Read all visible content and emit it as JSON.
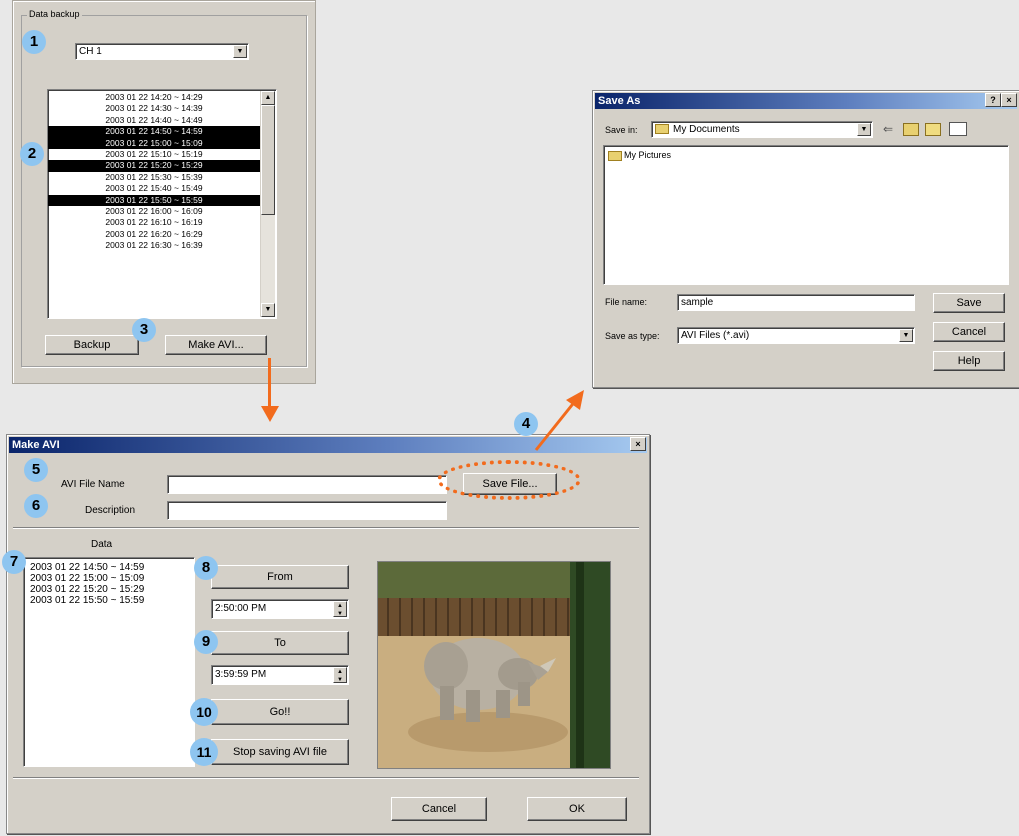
{
  "backup_panel": {
    "group_label": "Data backup",
    "channel_value": "CH 1",
    "list_items": [
      {
        "text": "2003 01 22 14:20 ~ 14:29",
        "selected": false
      },
      {
        "text": "2003 01 22 14:30 ~ 14:39",
        "selected": false
      },
      {
        "text": "2003 01 22 14:40 ~ 14:49",
        "selected": false
      },
      {
        "text": "2003 01 22 14:50 ~ 14:59",
        "selected": true
      },
      {
        "text": "2003 01 22 15:00 ~ 15:09",
        "selected": true
      },
      {
        "text": "2003 01 22 15:10 ~ 15:19",
        "selected": false
      },
      {
        "text": "2003 01 22 15:20 ~ 15:29",
        "selected": true
      },
      {
        "text": "2003 01 22 15:30 ~ 15:39",
        "selected": false
      },
      {
        "text": "2003 01 22 15:40 ~ 15:49",
        "selected": false
      },
      {
        "text": "2003 01 22 15:50 ~ 15:59",
        "selected": true
      },
      {
        "text": "2003 01 22 16:00 ~ 16:09",
        "selected": false
      },
      {
        "text": "2003 01 22 16:10 ~ 16:19",
        "selected": false
      },
      {
        "text": "2003 01 22 16:20 ~ 16:29",
        "selected": false
      },
      {
        "text": "2003 01 22 16:30 ~ 16:39",
        "selected": false
      }
    ],
    "backup_button": "Backup",
    "make_avi_button": "Make AVI..."
  },
  "save_as": {
    "title": "Save As",
    "help_btn": "?",
    "close_btn": "×",
    "save_in_label": "Save in:",
    "save_in_value": "My Documents",
    "folder_item": "My Pictures",
    "file_name_label": "File name:",
    "file_name_value": "sample",
    "save_type_label": "Save as type:",
    "save_type_value": "AVI Files (*.avi)",
    "save_button": "Save",
    "cancel_button": "Cancel",
    "help_button": "Help"
  },
  "make_avi": {
    "title": "Make AVI",
    "close_btn": "×",
    "avi_file_name_label": "AVI File Name",
    "avi_file_name_value": "",
    "description_label": "Description",
    "description_value": "",
    "save_file_button": "Save File...",
    "data_label": "Data",
    "data_items": [
      "2003 01 22 14:50 ~ 14:59",
      "2003 01 22 15:00 ~ 15:09",
      "2003 01 22 15:20 ~ 15:29",
      "2003 01 22 15:50 ~ 15:59"
    ],
    "from_button": "From",
    "from_time": "2:50:00 PM",
    "to_button": "To",
    "to_time": "3:59:59 PM",
    "go_button": "Go!!",
    "stop_button": "Stop saving AVI file",
    "cancel_button": "Cancel",
    "ok_button": "OK"
  },
  "badges": [
    "1",
    "2",
    "3",
    "4",
    "5",
    "6",
    "7",
    "8",
    "9",
    "10",
    "11"
  ],
  "colors": {
    "accent_orange": "#f26b1d",
    "badge_blue": "#8ec5f0",
    "title_bar": "#0a246a"
  }
}
